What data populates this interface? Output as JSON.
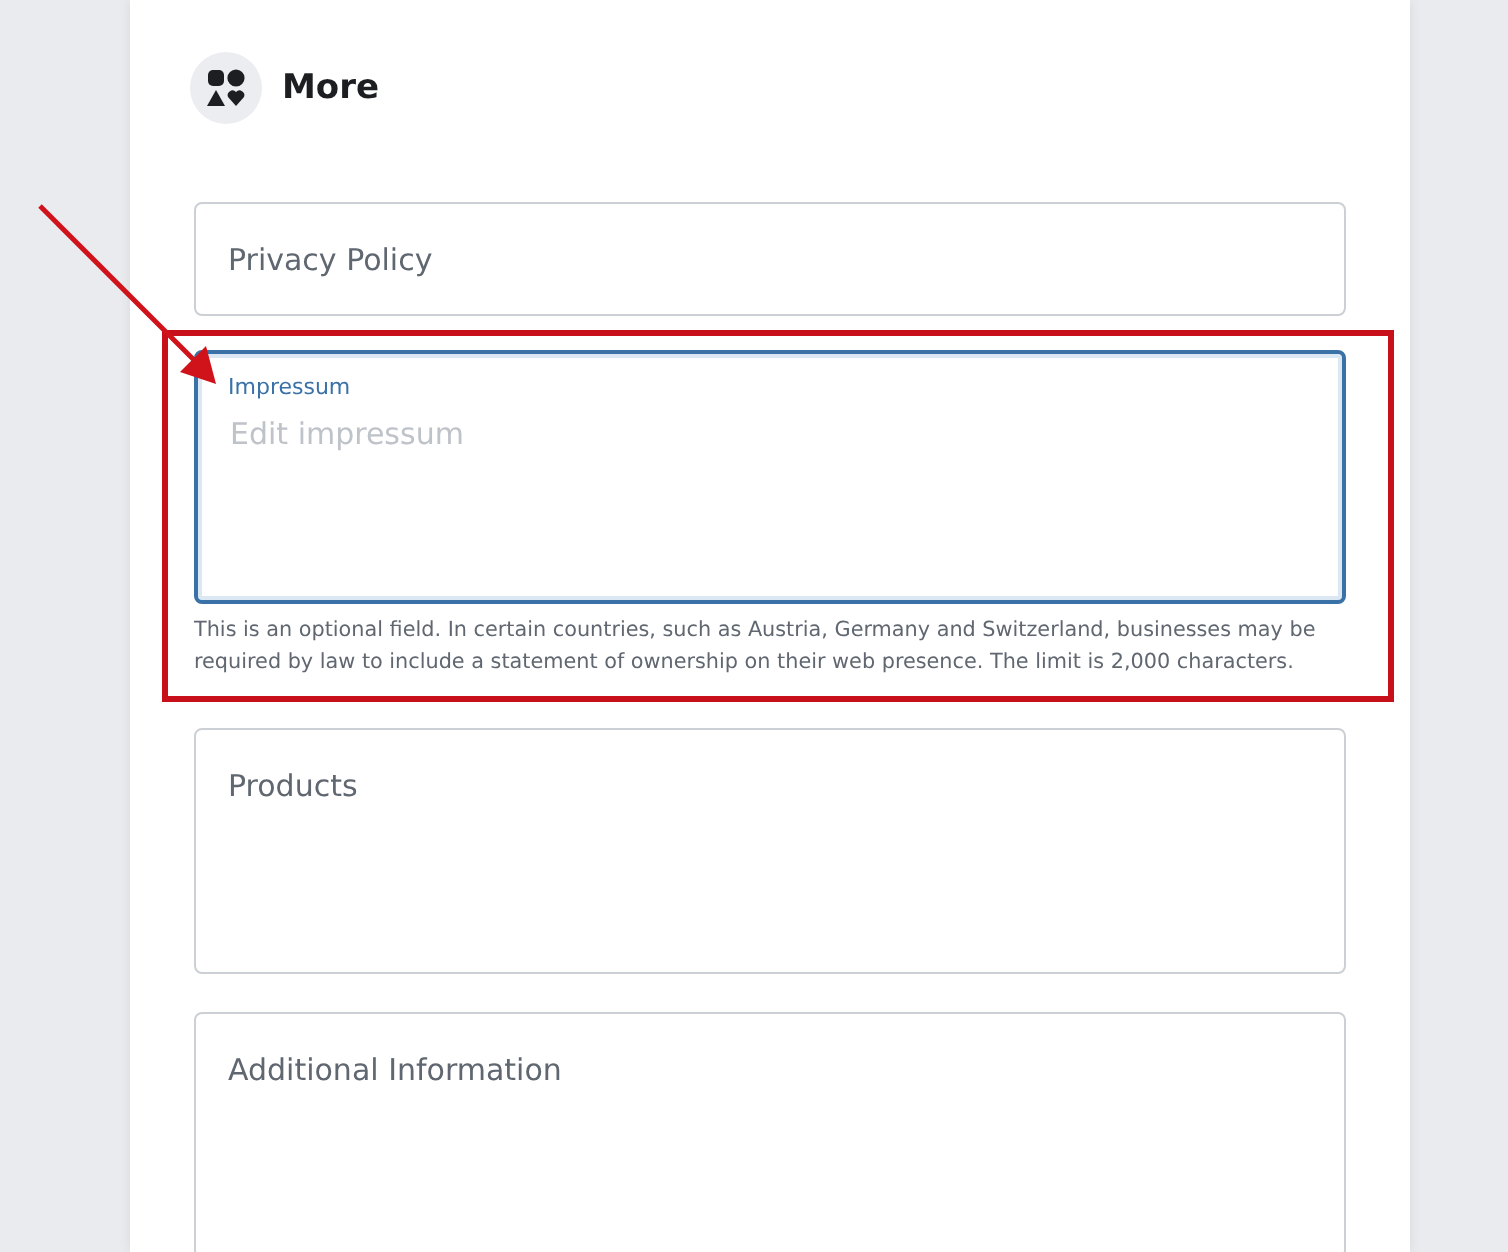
{
  "section": {
    "title": "More"
  },
  "fields": [
    {
      "kind": "input",
      "placeholder": "Privacy Policy",
      "focused": false,
      "highlighted": false
    },
    {
      "kind": "textarea",
      "label": "Impressum",
      "placeholder": "Edit impressum",
      "focused": true,
      "highlighted": true,
      "help": "This is an optional field. In certain countries, such as Austria, Germany and Switzerland, businesses may be required by law to include a statement of ownership on their web presence. The limit is 2,000 characters."
    },
    {
      "kind": "textarea",
      "placeholder": "Products",
      "focused": false,
      "highlighted": false
    },
    {
      "kind": "textarea",
      "placeholder": "Additional Information",
      "focused": false,
      "highlighted": false
    }
  ]
}
